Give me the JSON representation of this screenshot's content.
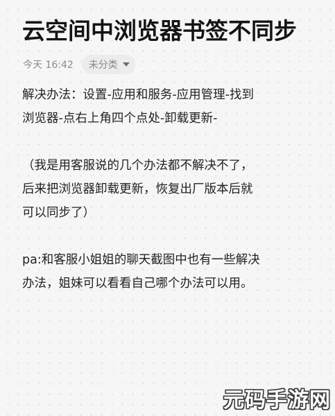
{
  "note": {
    "title": "云空间中浏览器书签不同步",
    "timestamp": "今天 16:42",
    "category": {
      "label": "未分类",
      "icon": "caret-down-icon"
    },
    "paragraphs": [
      {
        "lines": [
          "解决办法：设置-应用和服务-应用管理-找到",
          "浏览器-点右上角四个点处-卸载更新-"
        ]
      },
      {
        "lines": [
          "（我是用客服说的几个办法都不解决不了，",
          "后来把浏览器卸载更新，恢复出厂版本后就",
          "可以同步了）"
        ]
      },
      {
        "lines": [
          "pa:和客服小姐姐的聊天截图中也有一些解决",
          "办法，姐妹可以看看自己哪个办法可以用。"
        ]
      }
    ]
  },
  "watermark": {
    "text": "元码手游网"
  }
}
